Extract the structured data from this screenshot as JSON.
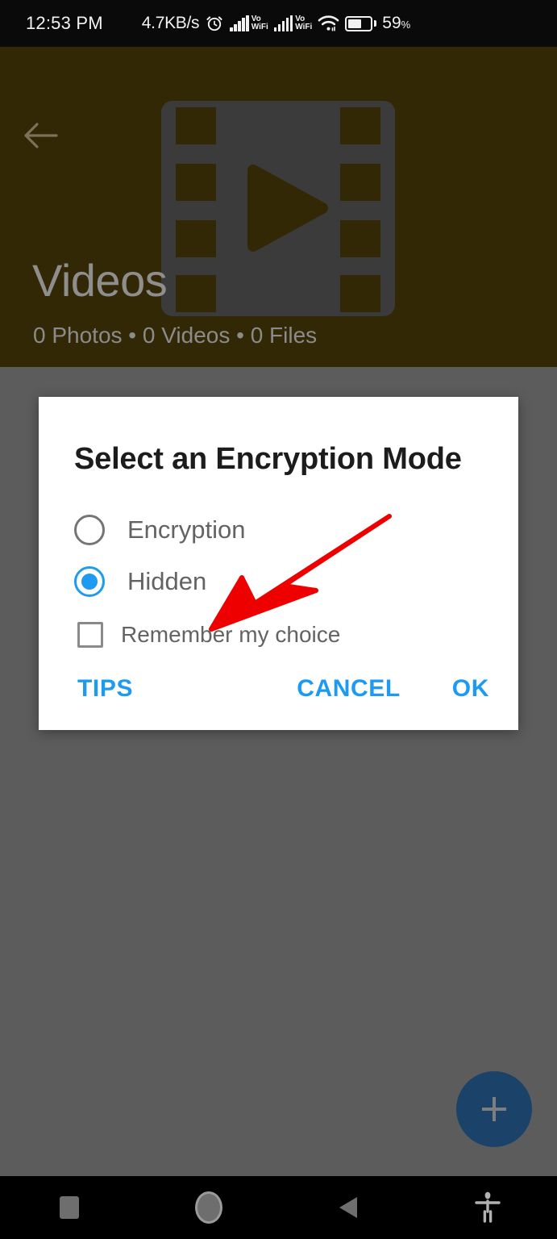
{
  "status_bar": {
    "clock": "12:53 PM",
    "network_speed": "4.7KB/s",
    "alarm_icon": "alarm-clock-icon",
    "sim1_label_top": "Vo",
    "sim1_label_bottom": "WiFi",
    "sim2_label_top": "Vo",
    "sim2_label_bottom": "WiFi",
    "wifi_icon": "wifi-icon",
    "battery_percent": "59",
    "battery_percent_symbol": "%",
    "battery_level": 59
  },
  "header": {
    "back_icon": "back-arrow-icon",
    "album_icon": "film-strip-play-icon",
    "title": "Videos",
    "meta": "0 Photos • 0 Videos • 0 Files",
    "background_color": "#332806",
    "text_color": "#8e8e8e"
  },
  "fab": {
    "icon": "plus-icon",
    "background_color": "#1b4268"
  },
  "dialog": {
    "title": "Select an Encryption Mode",
    "options": [
      {
        "label": "Encryption",
        "selected": false
      },
      {
        "label": "Hidden",
        "selected": true
      }
    ],
    "checkbox": {
      "label": "Remember my choice",
      "checked": false
    },
    "buttons": {
      "tips": "TIPS",
      "cancel": "CANCEL",
      "ok": "OK"
    },
    "accent_color": "#1e9bf0",
    "background_color": "#ffffff"
  },
  "annotation": {
    "arrow_color": "#ee0000",
    "points_to": "Hidden"
  },
  "nav_bar": {
    "recents_icon": "square-recents-icon",
    "home_icon": "circle-home-icon",
    "back_icon": "triangle-back-icon",
    "accessibility_icon": "accessibility-person-icon"
  },
  "scrim": {
    "color": "#5c5c5c"
  }
}
